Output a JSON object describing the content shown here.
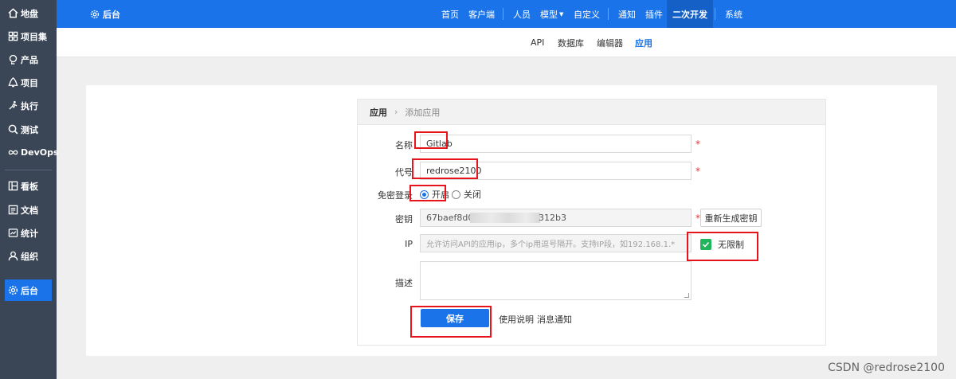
{
  "sidebar": {
    "items": [
      {
        "label": "地盘",
        "icon": "home-icon"
      },
      {
        "label": "项目集",
        "icon": "grid-icon"
      },
      {
        "label": "产品",
        "icon": "lightbulb-icon"
      },
      {
        "label": "项目",
        "icon": "bell-icon"
      },
      {
        "label": "执行",
        "icon": "run-icon"
      },
      {
        "label": "测试",
        "icon": "search-icon"
      },
      {
        "label": "DevOps",
        "icon": "infinity-icon"
      },
      {
        "label": "看板",
        "icon": "kanban-icon"
      },
      {
        "label": "文档",
        "icon": "document-icon"
      },
      {
        "label": "统计",
        "icon": "chart-icon"
      },
      {
        "label": "组织",
        "icon": "user-icon"
      },
      {
        "label": "后台",
        "icon": "gear-icon"
      }
    ],
    "active": "后台"
  },
  "topnav": {
    "brand": "后台",
    "items": [
      "首页",
      "客户端",
      "人员",
      "模型",
      "自定义",
      "通知",
      "插件",
      "二次开发",
      "系统"
    ],
    "active": "二次开发"
  },
  "subnav": {
    "items": [
      "API",
      "数据库",
      "编辑器",
      "应用"
    ],
    "active": "应用"
  },
  "breadcrumb": {
    "root": "应用",
    "separator": "›",
    "current": "添加应用"
  },
  "form": {
    "name_label": "名称",
    "name_value": "Gitlab",
    "code_label": "代号",
    "code_value": "redrose2100",
    "login_label": "免密登录",
    "login_on": "开启",
    "login_off": "关闭",
    "login_selected": "开启",
    "secret_label": "密钥",
    "secret_prefix": "67baef8d0",
    "secret_suffix": "312b3",
    "regen_label": "重新生成密钥",
    "ip_label": "IP",
    "ip_placeholder": "允许访问API的应用ip，多个ip用逗号隔开。支持IP段，如192.168.1.*",
    "unlimited_label": "无限制",
    "unlimited_checked": true,
    "desc_label": "描述",
    "required_mark": "*",
    "save_label": "保存",
    "usage_link": "使用说明",
    "notify_link": "消息通知"
  },
  "watermark": "CSDN @redrose2100",
  "colors": {
    "primary": "#1a73e8",
    "sidebar": "#3a4556",
    "highlight": "#e8141b",
    "check": "#20b55a"
  }
}
